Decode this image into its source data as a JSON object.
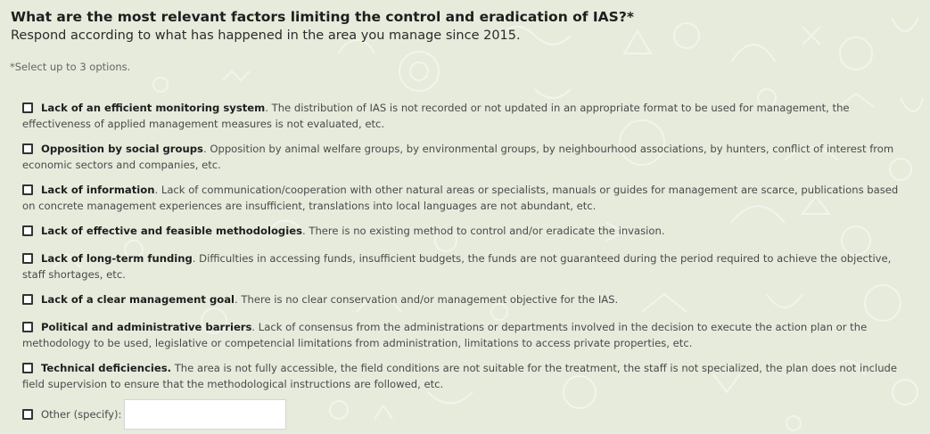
{
  "question": {
    "title": "What are the most relevant factors limiting the control and eradication of IAS?*",
    "subtitle": "Respond according to what has happened in the area you manage since 2015.",
    "note": "*Select up to 3 options."
  },
  "options": [
    {
      "label": "Lack of an efficient monitoring system",
      "sep": ". ",
      "text": "The distribution of IAS is not recorded or not updated in an appropriate format to be used for management, the effectiveness of applied management measures is not evaluated, etc.",
      "checked": false
    },
    {
      "label": "Opposition by social groups",
      "sep": ". ",
      "text": "Opposition by animal welfare groups, by environmental groups, by neighbourhood associations, by hunters, conflict of interest from economic sectors and companies, etc.",
      "checked": false
    },
    {
      "label": "Lack of information",
      "sep": ". ",
      "text": "Lack of communication/cooperation with other natural areas or specialists, manuals or guides for management are scarce, publications based on concrete management experiences are insufficient, translations into local languages are not abundant, etc.",
      "checked": false
    },
    {
      "label": "Lack of effective and feasible methodologies",
      "sep": ". ",
      "text": "There is no existing method to control and/or eradicate the invasion.",
      "checked": false
    },
    {
      "label": "Lack of long-term funding",
      "sep": ". ",
      "text": "Difficulties in accessing funds, insufficient budgets, the funds are not guaranteed during the period required to achieve the objective, staff shortages, etc.",
      "checked": false
    },
    {
      "label": "Lack of a clear management goal",
      "sep": ". ",
      "text": "There is no clear conservation and/or management objective for the IAS.",
      "checked": false
    },
    {
      "label": "Political and administrative barriers",
      "sep": ". ",
      "text": "Lack of consensus from the administrations or departments involved in the decision to execute the action plan or the methodology to be used, legislative or competencial limitations from administration, limitations to access private properties, etc.",
      "checked": false
    },
    {
      "label": "Technical deficiencies.",
      "sep": " ",
      "text": "The area is not fully accessible, the field conditions are not suitable for the treatment, the staff is not specialized, the plan does not include field supervision to ensure that the methodological instructions are followed, etc.",
      "checked": false
    }
  ],
  "other": {
    "label": "Other (specify):",
    "value": "",
    "checked": false
  },
  "colors": {
    "background": "#e6ebdc",
    "doodle": "#f4f6ee"
  }
}
